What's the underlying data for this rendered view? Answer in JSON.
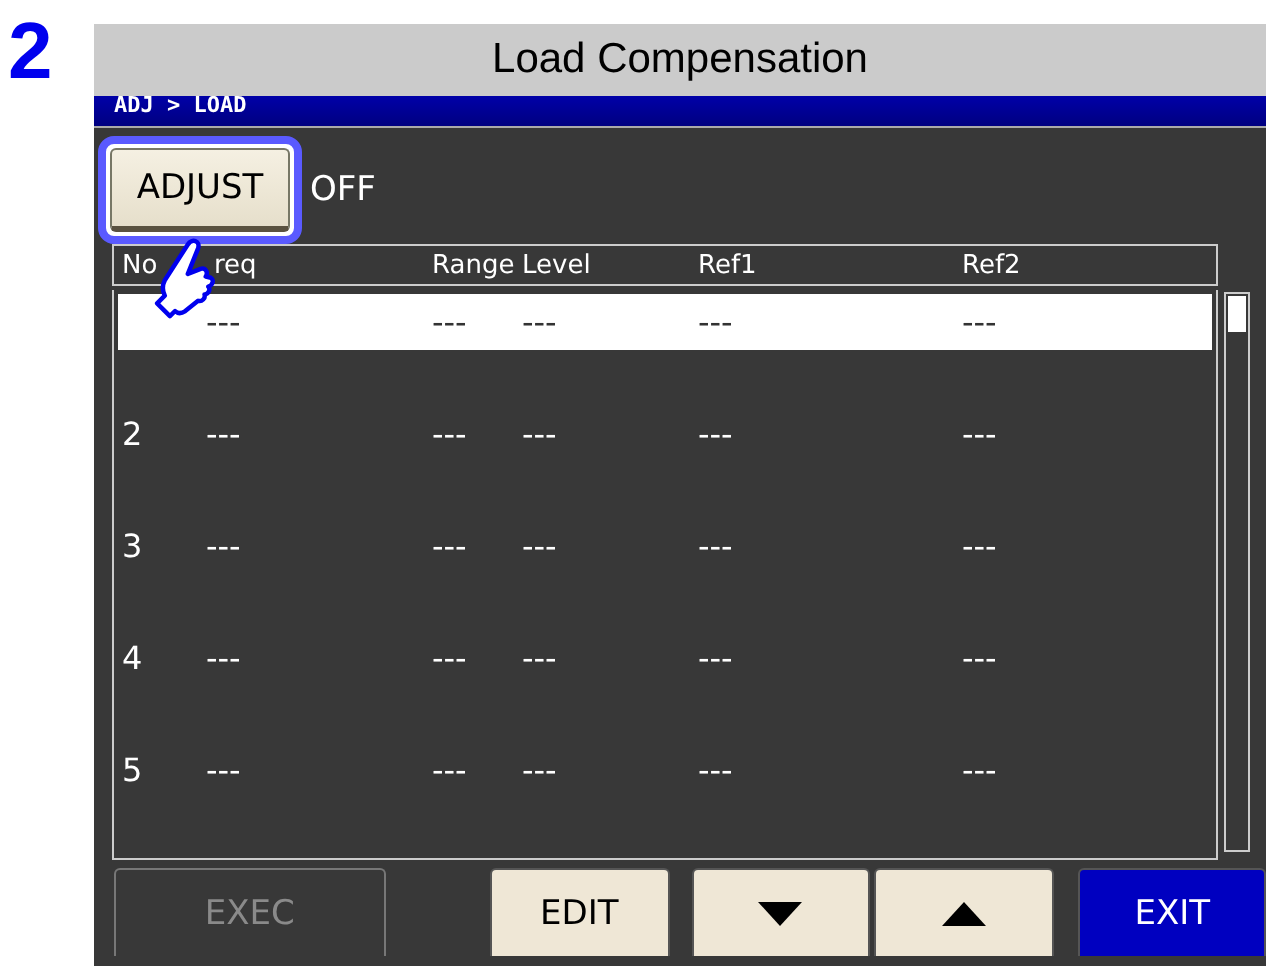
{
  "step": "2",
  "window": {
    "title": "Load Compensation",
    "breadcrumb": "ADJ > LOAD"
  },
  "adjust": {
    "label": "ADJUST",
    "highlighted": true,
    "state": "OFF"
  },
  "table": {
    "columns": [
      "No",
      "req",
      "Range",
      "Level",
      "Ref1",
      "Ref2"
    ],
    "rows": [
      {
        "selected": true,
        "cells": [
          "",
          "---",
          "---",
          "---",
          "---",
          "---"
        ]
      },
      {
        "selected": false,
        "cells": [
          "2",
          "---",
          "---",
          "---",
          "---",
          "---"
        ]
      },
      {
        "selected": false,
        "cells": [
          "3",
          "---",
          "---",
          "---",
          "---",
          "---"
        ]
      },
      {
        "selected": false,
        "cells": [
          "4",
          "---",
          "---",
          "---",
          "---",
          "---"
        ]
      },
      {
        "selected": false,
        "cells": [
          "5",
          "---",
          "---",
          "---",
          "---",
          "---"
        ]
      }
    ]
  },
  "buttons": [
    {
      "kind": "text",
      "label": "EXEC",
      "disabled": true
    },
    {
      "kind": "text",
      "label": "EDIT",
      "disabled": false
    },
    {
      "kind": "down",
      "disabled": false
    },
    {
      "kind": "up",
      "disabled": false
    },
    {
      "kind": "primary",
      "label": "EXIT",
      "disabled": false
    }
  ]
}
